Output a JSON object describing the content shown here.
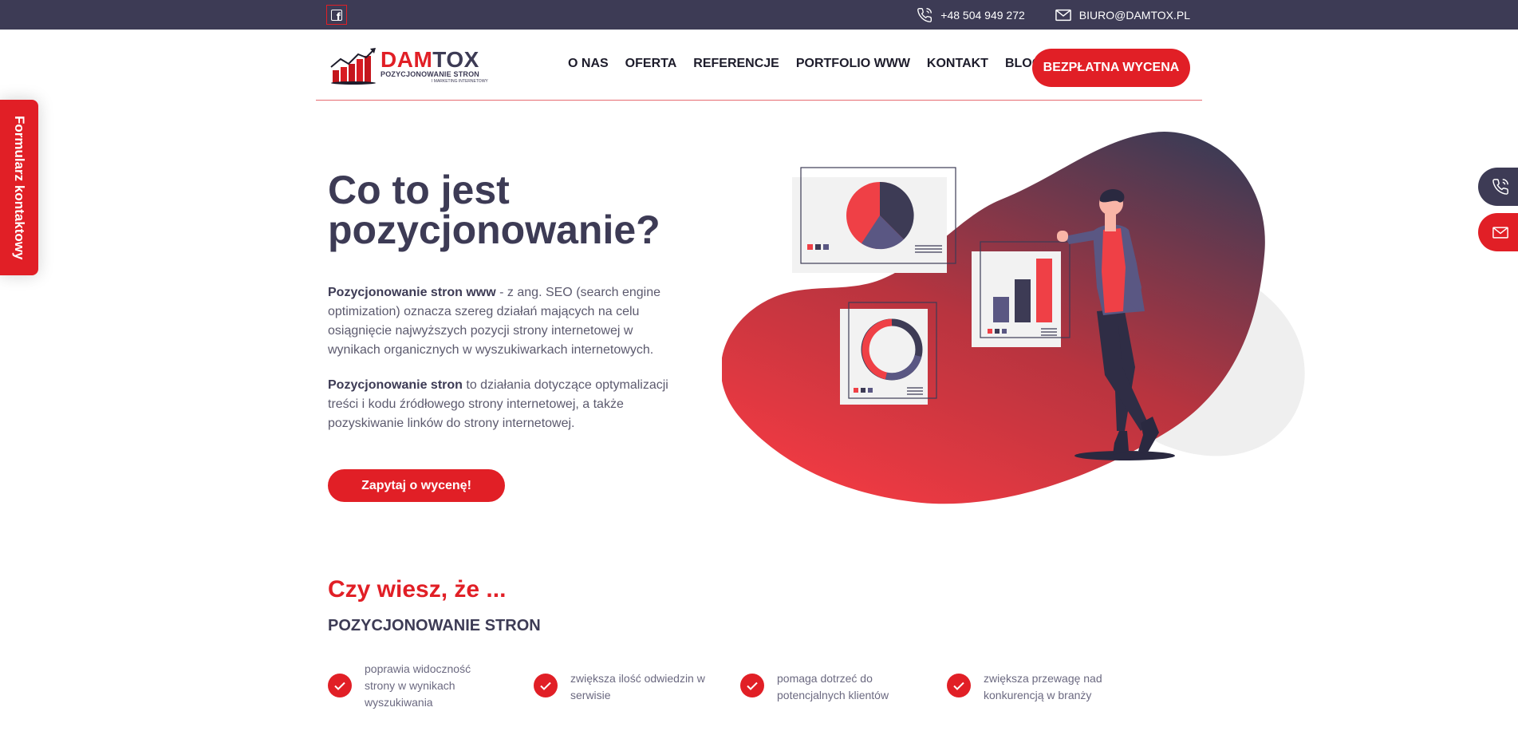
{
  "topbar": {
    "facebook_icon": "facebook-icon",
    "phone": "+48 504 949 272",
    "email": "BIURO@DAMTOX.PL"
  },
  "logo": {
    "brand_red": "DAM",
    "brand_dark": "TOX",
    "tagline": "POZYCJONOWANIE STRON",
    "tagline2": "I MARKETING INTERNETOWY"
  },
  "nav": {
    "items": [
      "O NAS",
      "OFERTA",
      "REFERENCJE",
      "PORTFOLIO WWW",
      "KONTAKT",
      "BLOG"
    ],
    "cta": "BEZPŁATNA WYCENA"
  },
  "side": {
    "form_label": "Formularz kontaktowy",
    "phone_icon": "phone-icon",
    "mail_icon": "mail-icon"
  },
  "hero": {
    "title": "Co to jest pozycjonowanie?",
    "p1_bold": "Pozycjonowanie stron www",
    "p1_rest": " - z ang. SEO (search engine optimization) oznacza szereg działań mających na celu osiągnięcie najwyższych pozycji strony internetowej w wynikach organicznych w wyszukiwarkach internetowych.",
    "p2_bold": "Pozycjonowanie stron",
    "p2_rest": " to działania dotyczące optymalizacji treści i kodu źródłowego strony internetowej, a także pozyskiwanie linków do strony internetowej.",
    "button": "Zapytaj o wycenę!"
  },
  "section": {
    "title": "Czy wiesz, że ...",
    "subtitle": "POZYCJONOWANIE STRON",
    "features": [
      "poprawia widoczność strony w wynikach wyszukiwania",
      "zwiększa ilość odwiedzin w serwisie",
      "pomaga dotrzeć do potencjalnych klientów",
      "zwiększa przewagę nad konkurencją w branży"
    ]
  },
  "colors": {
    "primary": "#e11f26",
    "dark": "#3d3b55",
    "topbar": "#3d3b55"
  }
}
